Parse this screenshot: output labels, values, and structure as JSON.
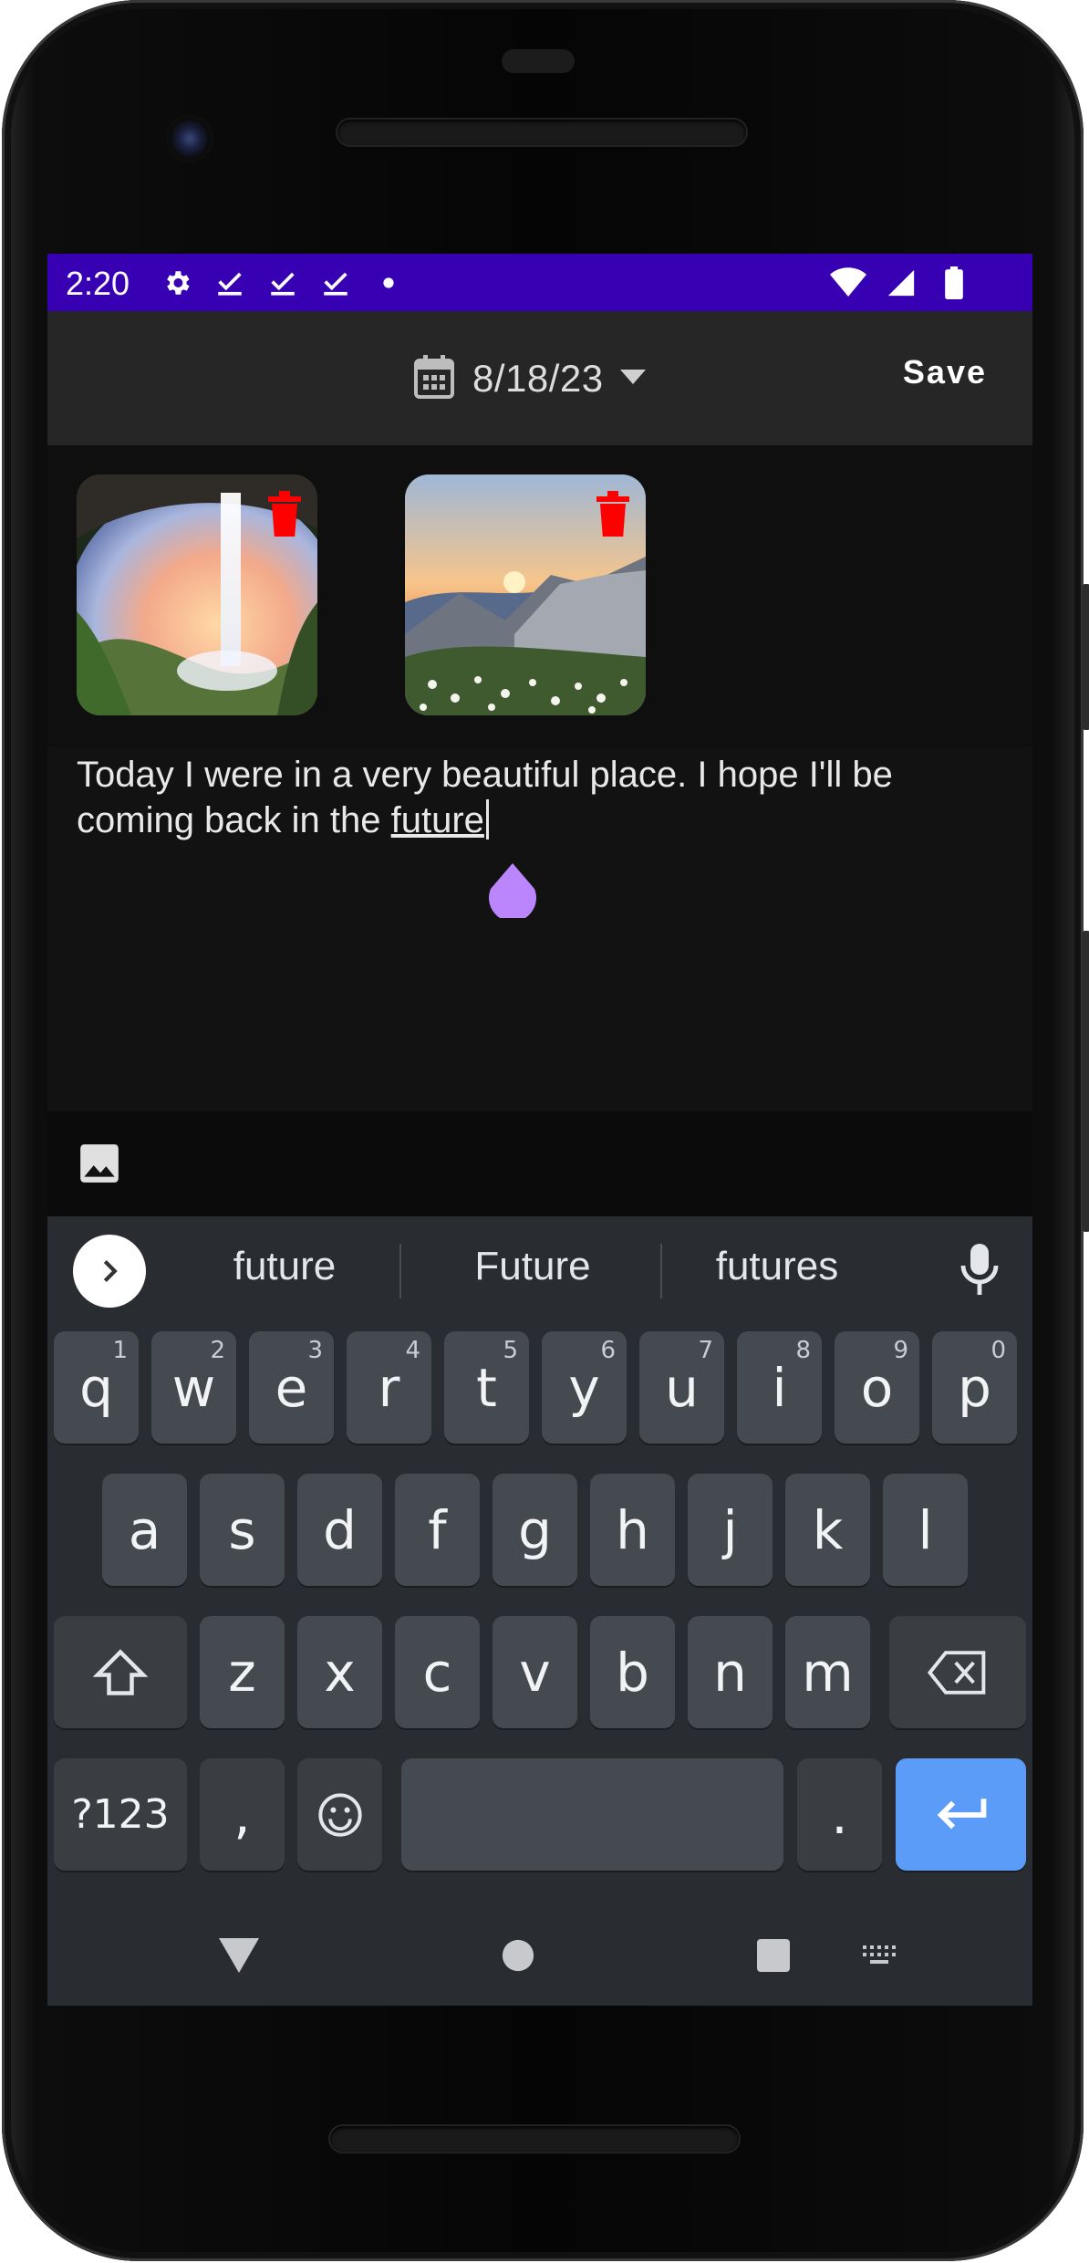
{
  "status_bar": {
    "time": "2:20",
    "left_icons": [
      "gear-icon",
      "check-icon",
      "check-icon",
      "check-icon",
      "dot-icon"
    ],
    "right_icons": [
      "wifi-icon",
      "signal-icon",
      "battery-icon"
    ]
  },
  "app_bar": {
    "date": "8/18/23",
    "save_label": "Save"
  },
  "photos": [
    {
      "subject": "waterfall-cave",
      "delete_icon": "trash-icon"
    },
    {
      "subject": "mountain-sunset-flowers",
      "delete_icon": "trash-icon"
    }
  ],
  "editor": {
    "text_before": "Today I were in a very beautiful place. I hope I'll be coming back in the ",
    "underlined_word": "future"
  },
  "toolbar": {
    "icon": "image-icon"
  },
  "keyboard": {
    "suggestions": [
      "future",
      "Future",
      "futures"
    ],
    "row1": [
      {
        "key": "q",
        "hint": "1"
      },
      {
        "key": "w",
        "hint": "2"
      },
      {
        "key": "e",
        "hint": "3"
      },
      {
        "key": "r",
        "hint": "4"
      },
      {
        "key": "t",
        "hint": "5"
      },
      {
        "key": "y",
        "hint": "6"
      },
      {
        "key": "u",
        "hint": "7"
      },
      {
        "key": "i",
        "hint": "8"
      },
      {
        "key": "o",
        "hint": "9"
      },
      {
        "key": "p",
        "hint": "0"
      }
    ],
    "row2": [
      "a",
      "s",
      "d",
      "f",
      "g",
      "h",
      "j",
      "k",
      "l"
    ],
    "row3": [
      "z",
      "x",
      "c",
      "v",
      "b",
      "n",
      "m"
    ],
    "symbols_label": "?123",
    "comma_label": ",",
    "period_label": ".",
    "colors": {
      "enter": "#5a9cf8",
      "key": "#454a50",
      "background": "#292c30"
    }
  },
  "colors": {
    "status_bar": "#3700b3",
    "app_bar": "#262626",
    "delete": "#ff0000",
    "cursor_handle": "#bb86fc"
  }
}
